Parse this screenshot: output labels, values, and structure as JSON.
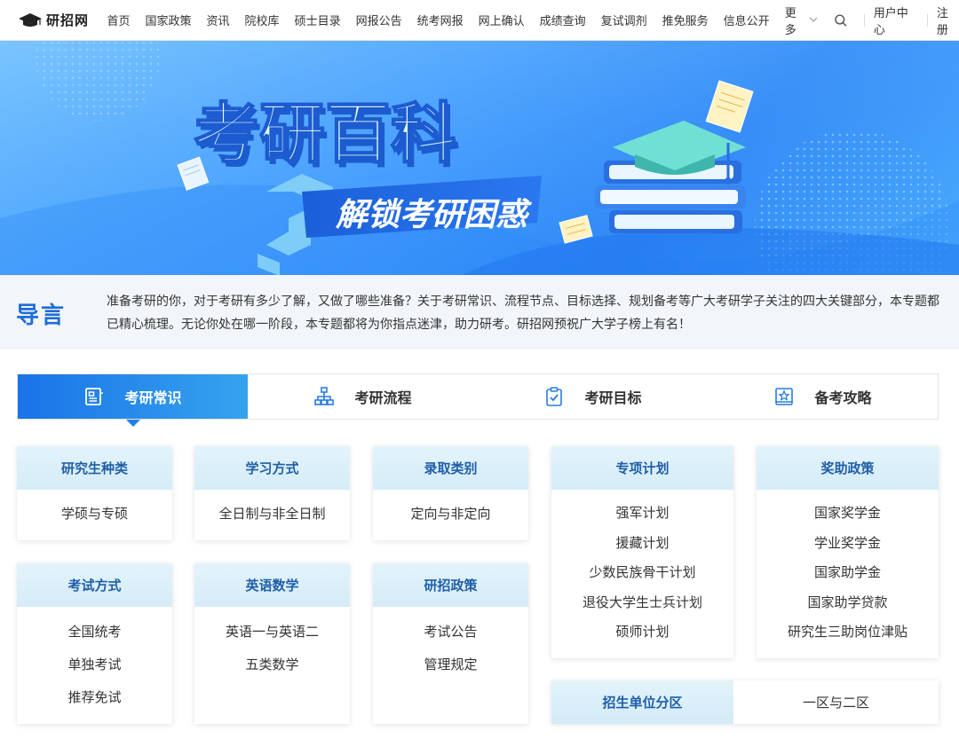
{
  "nav": {
    "logo_text": "研招网",
    "links": [
      "首页",
      "国家政策",
      "资讯",
      "院校库",
      "硕士目录",
      "网报公告",
      "统考网报",
      "网上确认",
      "成绩查询",
      "复试调剂",
      "推免服务",
      "信息公开"
    ],
    "more_label": "更多",
    "user_center": "用户中心",
    "register": "注册"
  },
  "banner": {
    "title": "考研百科",
    "subtitle": "解锁考研困惑"
  },
  "intro": {
    "title": "导言",
    "text": "准备考研的你，对于考研有多少了解，又做了哪些准备？关于考研常识、流程节点、目标选择、规划备考等广大考研学子关注的四大关键部分，本专题都已精心梳理。无论你处在哪一阶段，本专题都将为你指点迷津，助力研考。研招网预祝广大学子榜上有名！"
  },
  "tabs": [
    {
      "label": "考研常识",
      "icon": "document-icon",
      "active": true
    },
    {
      "label": "考研流程",
      "icon": "flowchart-icon",
      "active": false
    },
    {
      "label": "考研目标",
      "icon": "clipboard-check-icon",
      "active": false
    },
    {
      "label": "备考攻略",
      "icon": "book-star-icon",
      "active": false
    }
  ],
  "cards": {
    "graduate_types": {
      "title": "研究生种类",
      "items": [
        "学硕与专硕"
      ]
    },
    "study_mode": {
      "title": "学习方式",
      "items": [
        "全日制与非全日制"
      ]
    },
    "admission_type": {
      "title": "录取类别",
      "items": [
        "定向与非定向"
      ]
    },
    "special_plans": {
      "title": "专项计划",
      "items": [
        "强军计划",
        "援藏计划",
        "少数民族骨干计划",
        "退役大学生士兵计划",
        "硕师计划"
      ]
    },
    "scholarships": {
      "title": "奖助政策",
      "items": [
        "国家奖学金",
        "学业奖学金",
        "国家助学金",
        "国家助学贷款",
        "研究生三助岗位津贴"
      ]
    },
    "exam_mode": {
      "title": "考试方式",
      "items": [
        "全国统考",
        "单独考试",
        "推荐免试"
      ]
    },
    "english_math": {
      "title": "英语数学",
      "items": [
        "英语一与英语二",
        "五类数学"
      ]
    },
    "policy": {
      "title": "研招政策",
      "items": [
        "考试公告",
        "管理规定"
      ]
    }
  },
  "zone": {
    "label": "招生单位分区",
    "value": "一区与二区"
  },
  "colors": {
    "primary": "#1a73e8",
    "card_header_text": "#1f5fa8",
    "card_header_bg": "#e3f3fb",
    "intro_bg": "#f2f5f9"
  }
}
